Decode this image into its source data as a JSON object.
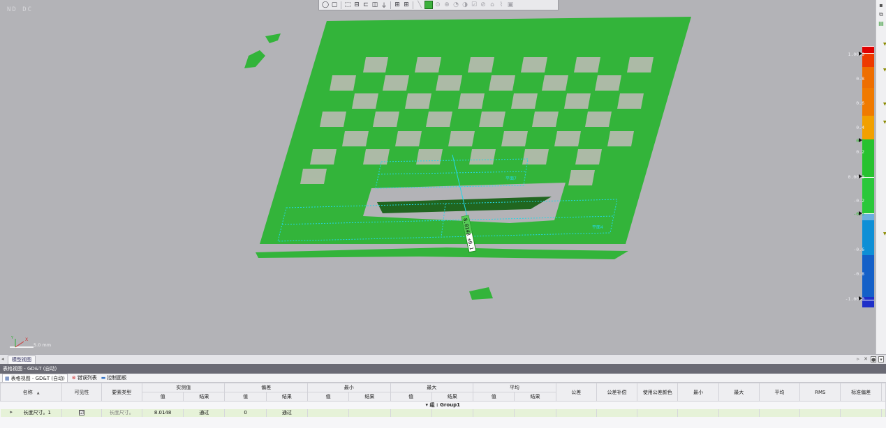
{
  "viewport": {
    "nd_label": "ND DC",
    "plane_labels": [
      "平面7",
      "平面4"
    ],
    "dimension_label": "8.0148 ±0.1"
  },
  "toolbar": {
    "icons": [
      "sphere-icon",
      "cube-view-icon",
      "iso-view-icon",
      "front-view-icon",
      "top-view-icon",
      "side-view-icon",
      "section-icon",
      "grid-view-icon",
      "layout-icon",
      "line-icon",
      "plane-fill-icon",
      "target-icon",
      "point-icon",
      "curve-icon",
      "probe-icon",
      "check-icon",
      "rotate-icon",
      "measure-icon",
      "link-icon",
      "save-icon"
    ]
  },
  "color_bar": {
    "colors": {
      "max": "#e00000",
      "high": "#ee6e00",
      "mid_high": "#f2a000",
      "in_tol": "#27c22f",
      "low": "#0e8fd6",
      "min": "#1f2fc8"
    },
    "labels": [
      {
        "text": "1.0000",
        "selected": false
      },
      {
        "text": "0.8",
        "selected": false
      },
      {
        "text": "0.6",
        "selected": false
      },
      {
        "text": "0.4",
        "selected": false
      },
      {
        "text": "0.3",
        "selected": true
      },
      {
        "text": "0.2",
        "selected": false
      },
      {
        "text": "0.0000",
        "selected": false
      },
      {
        "text": "-0.2",
        "selected": false
      },
      {
        "text": "-0.3",
        "selected": true
      },
      {
        "text": "-0.6",
        "selected": false
      },
      {
        "text": "-0.8",
        "selected": false
      },
      {
        "text": "-1.0000",
        "selected": false
      }
    ]
  },
  "scale": {
    "text": "5.0 mm",
    "axis_x": "X",
    "axis_y": "Y"
  },
  "model_tab": {
    "label": "模型视图"
  },
  "panel": {
    "header": "表格视图 - GD&T (自动)",
    "tabs": [
      {
        "label": "表格视图 - GD&T (自动)"
      },
      {
        "label": "错误列表"
      },
      {
        "label": "控制面板"
      }
    ],
    "columns": {
      "name": "名称",
      "visibility": "可见性",
      "feature_type": "要素类型",
      "measured": "实测值",
      "deviation": "偏差",
      "min": "最小",
      "max": "最大",
      "avg": "平均",
      "tolerance": "公差",
      "tol_comp": "公差补偿",
      "use_tol_color": "使用公差颜色",
      "min2": "最小",
      "max2": "最大",
      "avg2": "平均",
      "rms": "RMS",
      "std": "标准偏差",
      "sub_value": "值",
      "sub_result": "结果"
    },
    "group": {
      "label": "组 : Group1"
    },
    "rows": [
      {
        "name": "长度尺寸。1",
        "visible": "☑",
        "feature_type": "长度尺寸。",
        "measured_value": "8.0148",
        "measured_result": "通过",
        "deviation_value": "0",
        "deviation_result": "通过"
      }
    ]
  }
}
